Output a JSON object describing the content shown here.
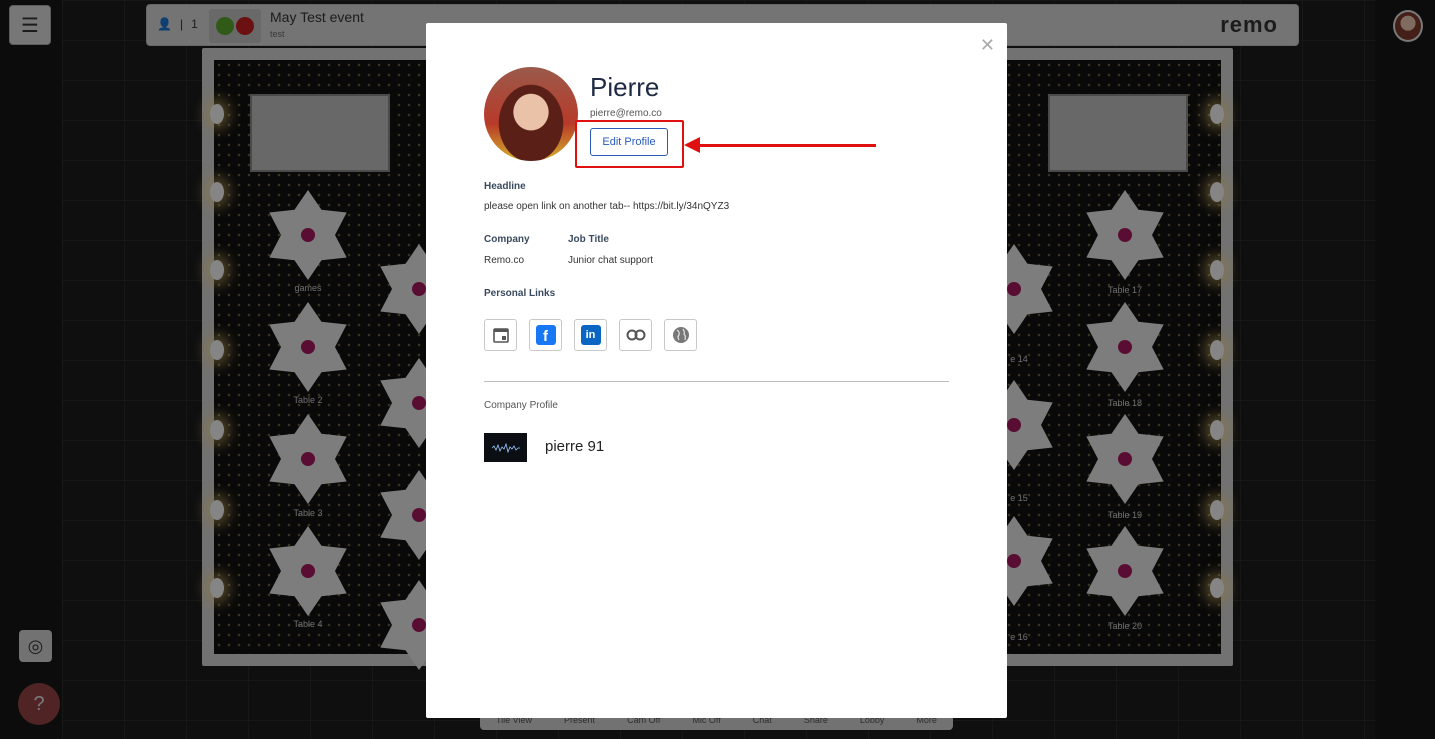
{
  "topbar": {
    "attendee_count": "1",
    "event_title": "May Test event",
    "event_subtitle": "test",
    "logo": "remo"
  },
  "tables": {
    "games": "games",
    "t2": "Table 2",
    "t3": "Table 3",
    "t4": "Table 4",
    "t17": "Table 17",
    "t18": "Table 18",
    "t19": "Table 19",
    "t20": "Table 20",
    "t14": "e 14",
    "t15": "e 15",
    "t16": "e 16"
  },
  "bottom_bar": [
    "Tile View",
    "Present",
    "Cam Off",
    "Mic Off",
    "Chat",
    "Share",
    "Lobby",
    "More"
  ],
  "profile": {
    "name": "Pierre",
    "email": "pierre@remo.co",
    "edit_label": "Edit Profile",
    "headline_label": "Headline",
    "headline": "please open link on another tab-- https://bit.ly/34nQYZ3",
    "company_label": "Company",
    "company": "Remo.co",
    "job_title_label": "Job Title",
    "job_title": "Junior chat support",
    "links_label": "Personal Links",
    "company_profile_label": "Company Profile",
    "company_name": "pierre 91"
  },
  "icons": {
    "menu": "hamburger-icon",
    "close": "close-icon",
    "calendar": "calendar-icon",
    "facebook": "facebook-icon",
    "linkedin": "linkedin-icon",
    "other": "infinity-icon",
    "website": "globe-icon",
    "locate": "locate-icon",
    "help": "help-icon"
  },
  "colors": {
    "accent": "#2a5bb8",
    "annotation": "#e01010",
    "table_center": "#a3195b"
  }
}
